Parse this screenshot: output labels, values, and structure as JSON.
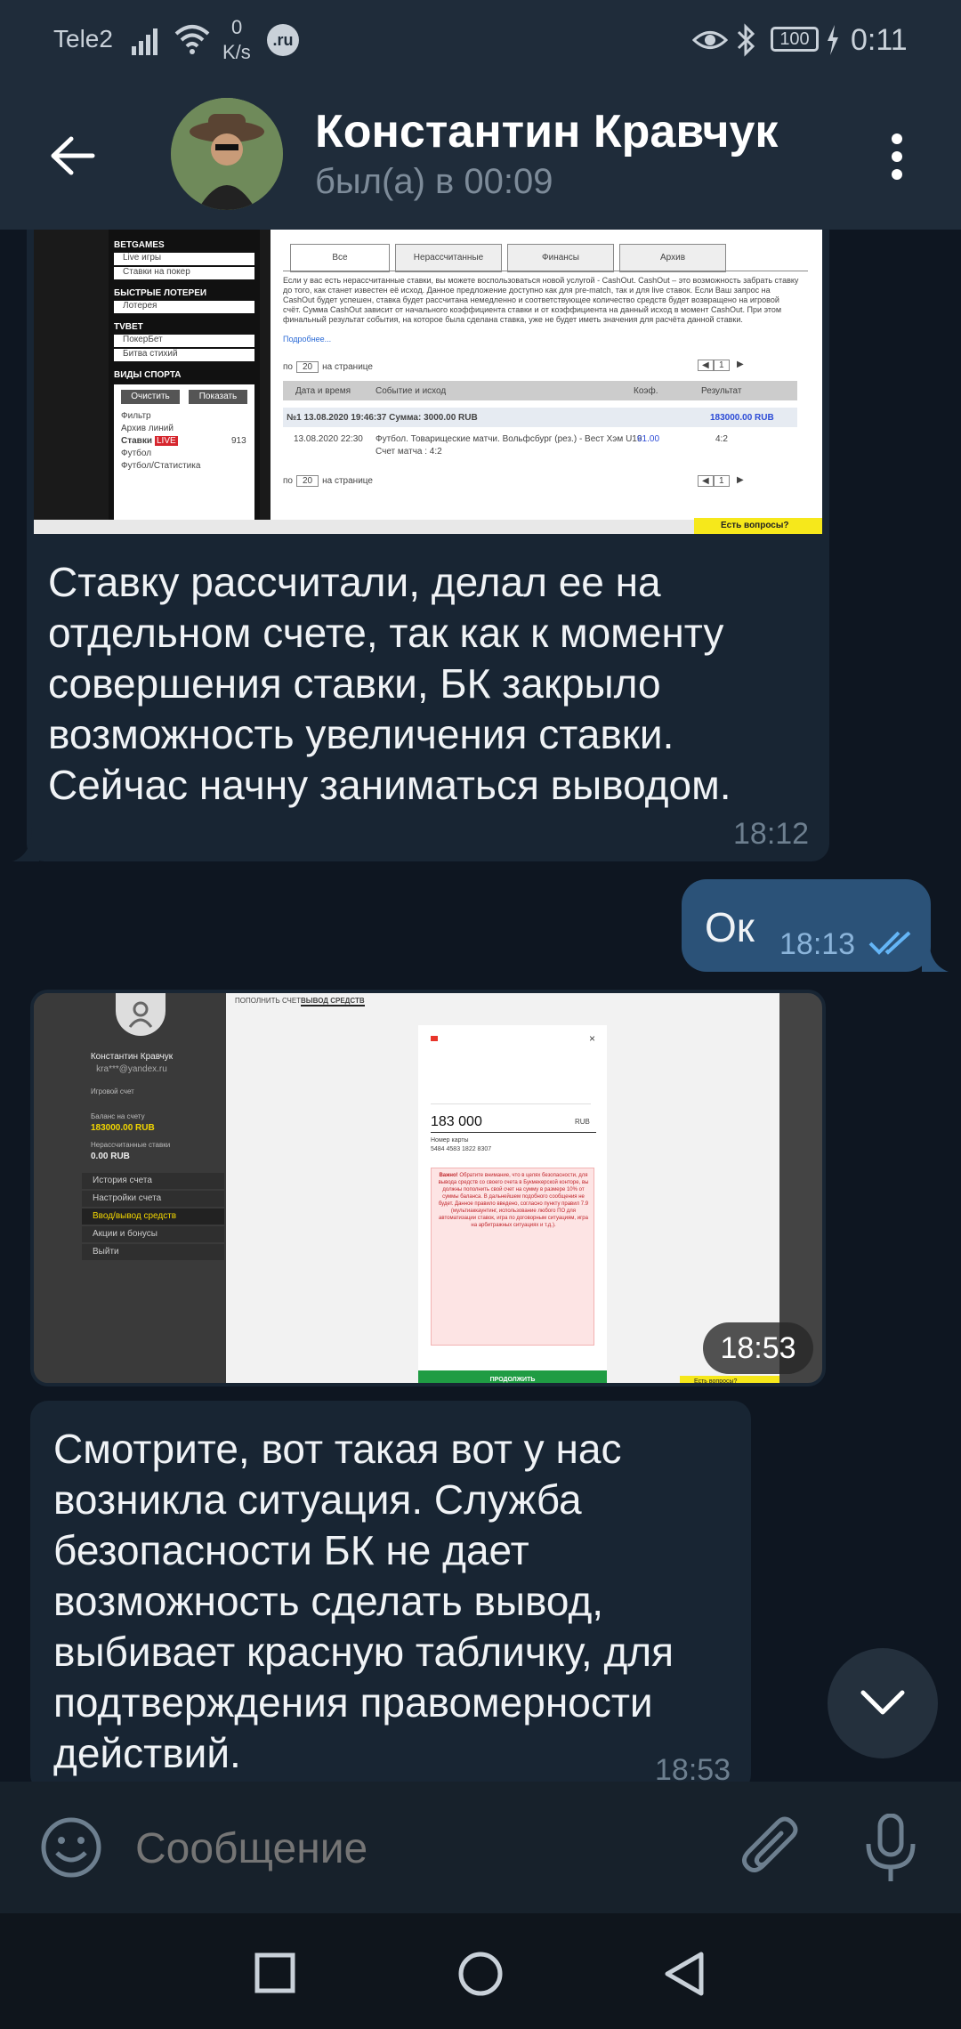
{
  "status_bar": {
    "carrier": "Tele2",
    "speed_value": "0",
    "speed_unit": "K/s",
    "ru_badge": ".ru",
    "battery": "100",
    "time": "0:11"
  },
  "header": {
    "name": "Константин Кравчук",
    "last_seen": "был(а) в 00:09"
  },
  "screenshot1": {
    "sidebar_sections": [
      "BETGAMES",
      "Live игры",
      "Ставки на покер",
      "БЫСТРЫЕ ЛОТЕРЕИ",
      "Лотерея",
      "TVBET",
      "ПокерБет",
      "Битва стихий",
      "ВИДЫ СПОРТА"
    ],
    "btn_clear": "Очистить",
    "btn_show": "Показать",
    "sport_items": [
      "Фильтр",
      "Архив линий",
      "Ставки",
      "Футбол",
      "Футбол/Статистика"
    ],
    "live_badge": "LIVE",
    "bets_count": "913",
    "tabs": [
      "Все",
      "Нерассчитанные",
      "Финансы",
      "Архив"
    ],
    "paragraph": "Если у вас есть нерассчитанные ставки, вы можете воспользоваться новой услугой - CashOut. CashOut – это возможность забрать ставку до того, как станет известен её исход. Данное предложение доступно как для pre-match, так и для live ставок. Если Ваш запрос на CashOut будет успешен, ставка будет рассчитана немедленно и соответствующее количество средств будет возвращено на игровой счёт. Сумма CashOut зависит от начального коэффициента ставки и от коэффициента на данный исход в момент CashOut. При этом финальный результат события, на которое была сделана ставка, уже не будет иметь значения для расчёта данной ставки.",
    "more_link": "Подробнее...",
    "per_page_prefix": "по",
    "per_page_value": "20",
    "per_page_suffix": "на странице",
    "page_number": "1",
    "col_datetime": "Дата и время",
    "col_event": "Событие и исход",
    "col_coef": "Коэф.",
    "col_result": "Результат",
    "bet_header": "№1  13.08.2020 19:46:37  Сумма: 3000.00 RUB",
    "bet_result_total": "183000.00 RUB",
    "bet_time": "13.08.2020 22:30",
    "bet_event": "Футбол. Товарищеские матчи. Вольфсбург (рез.) - Вест Хэм U19",
    "bet_score": "Счет матча : 4:2",
    "bet_coef": "61.00",
    "bet_result": "4:2",
    "help_button": "Есть вопросы?"
  },
  "message1": {
    "text": "Ставку рассчитали, делал ее на отдельном счете, так как к моменту совершения ставки, БК закрыло возможность увеличения ставки. Сейчас начну заниматься выводом.",
    "time": "18:12"
  },
  "message2": {
    "text": "Ок",
    "time": "18:13"
  },
  "screenshot2": {
    "profile_name": "Константин Кравчук",
    "profile_email": "kra***@yandex.ru",
    "account_label": "Игровой счет",
    "balance_label": "Баланс на счету",
    "balance_value": "183000.00 RUB",
    "uncalc_label": "Нерассчитанные ставки",
    "uncalc_value": "0.00 RUB",
    "menu": [
      "История счета",
      "Настройки счета",
      "Ввод/вывод средств",
      "Акции и бонусы",
      "Выйти"
    ],
    "tab_deposit": "ПОПОЛНИТЬ СЧЕТ",
    "tab_withdraw": "ВЫВОД СРЕДСТВ",
    "modal_amount": "183 000",
    "modal_currency": "RUB",
    "card_label": "Номер карты",
    "card_number": "5484 4583 1822 8307",
    "warning_title": "Важно!",
    "warning_text": "Обратите внимание, что в целях безопасности, для вывода средств со своего счета в Букмекерской конторе, вы должны пополнить свой счет на сумму в размере 10% от суммы баланса. В дальнейшем подобного сообщения не будет. Данное правило введено, согласно пункту правил 7.9 (мультиаккаунтинг, использование любого ПО для автоматизации ставок, игра по договорным ситуациям, игра на арбитражных ситуациях и т.д.).",
    "continue_button": "ПРОДОЛЖИТЬ",
    "overlay_time": "18:53",
    "help_button": "Есть вопросы?"
  },
  "message3": {
    "text": "Смотрите, вот такая вот у нас возникла ситуация. Служба безопасности БК не дает возможность сделать вывод, выбивает красную табличку, для подтверждения правомерности действий.",
    "time": "18:53"
  },
  "composer": {
    "placeholder": "Сообщение"
  },
  "colors": {
    "header_bg": "#1f2c3a",
    "chat_bg": "#0e1621",
    "incoming_bubble": "#182533",
    "outgoing_bubble": "#2b5278",
    "accent_check": "#64b5f6"
  }
}
